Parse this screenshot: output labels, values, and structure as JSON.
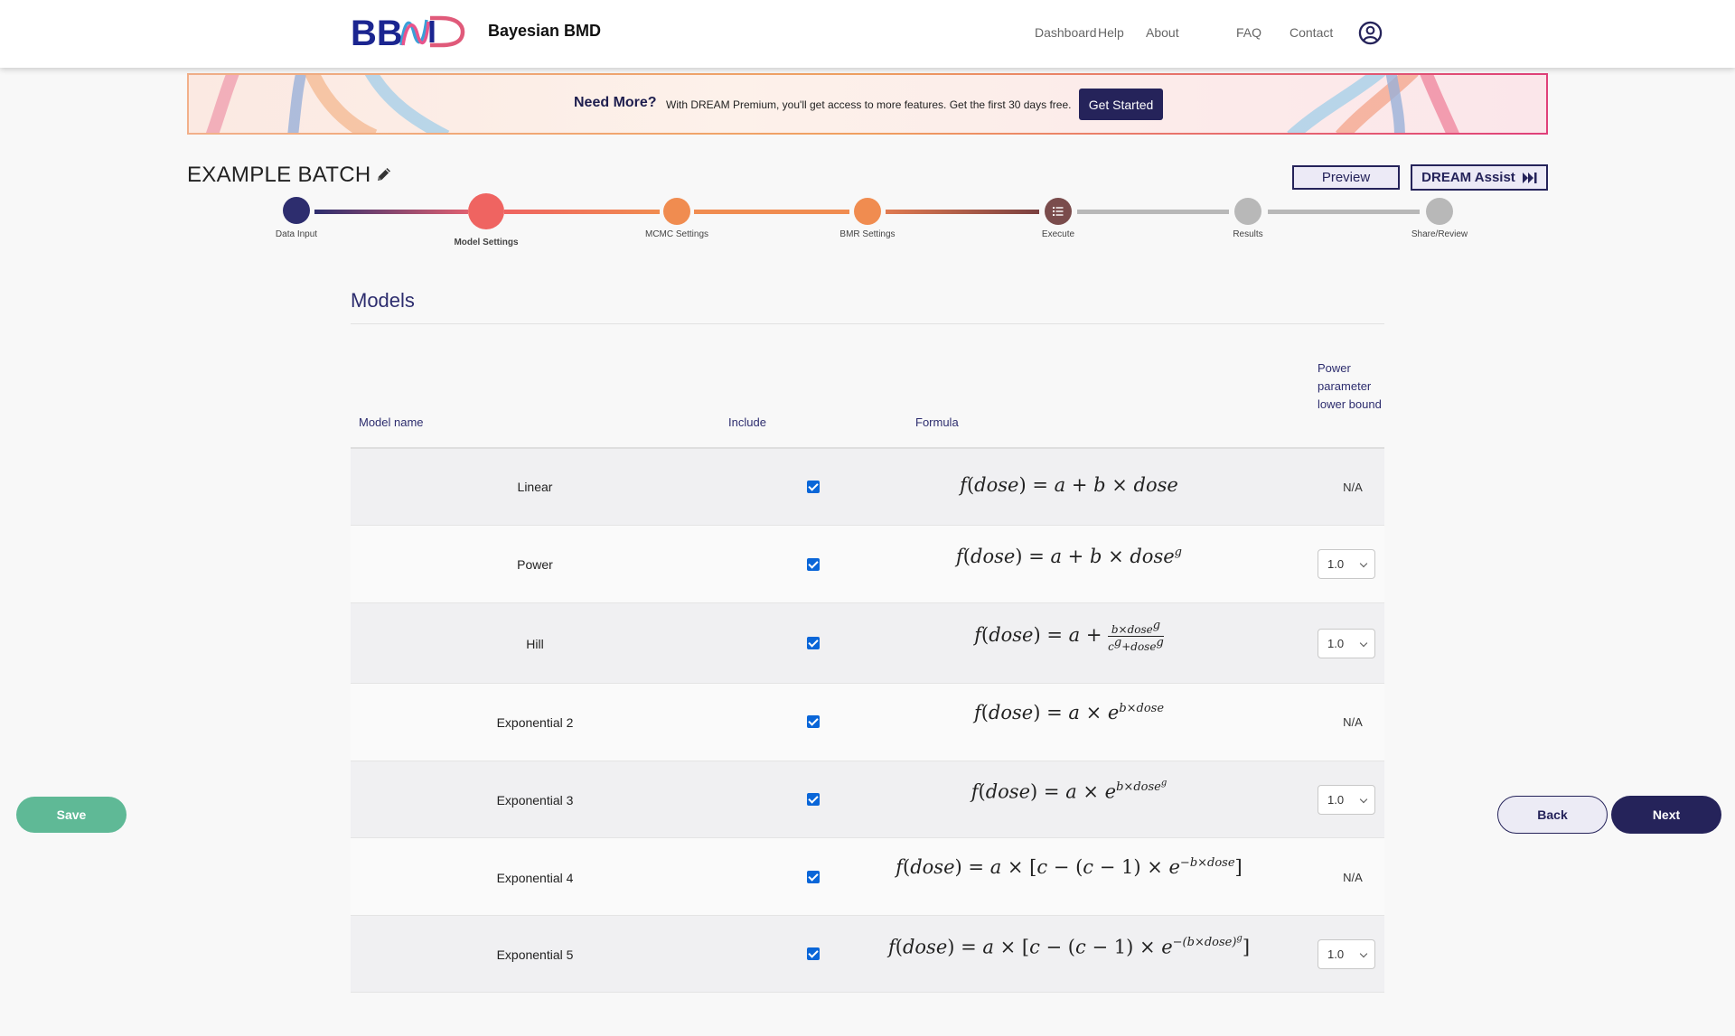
{
  "header": {
    "app_name": "Bayesian BMD",
    "logo_text": "BBMD",
    "nav": [
      "Dashboard",
      "Help",
      "About",
      "FAQ",
      "Contact"
    ],
    "user_icon": "user-circle-icon"
  },
  "banner": {
    "title": "Need More?",
    "text": "With DREAM Premium, you'll get access to more features. Get the first 30 days free.",
    "cta": "Get Started"
  },
  "batch": {
    "title": "EXAMPLE BATCH",
    "edit_icon": "pencil-icon",
    "preview_label": "Preview",
    "assist_label": "DREAM Assist",
    "assist_icon": "fast-forward-icon"
  },
  "stepper": {
    "steps": [
      "Data Input",
      "Model Settings",
      "MCMC Settings",
      "BMR Settings",
      "Execute",
      "Results",
      "Share/Review"
    ],
    "active_step": "Model Settings",
    "colors": {
      "done": "#2d2d6e",
      "active": "#ef6461",
      "upcoming": "#f08c50",
      "execute": "#7a4c4c",
      "inactive": "#b8b8b8"
    }
  },
  "models": {
    "section_title": "Models",
    "headers": {
      "name": "Model name",
      "include": "Include",
      "formula": "Formula",
      "power": "Power parameter lower bound"
    },
    "rows": [
      {
        "name": "Linear",
        "include": true,
        "power": "N/A"
      },
      {
        "name": "Power",
        "include": true,
        "power": "1.0"
      },
      {
        "name": "Hill",
        "include": true,
        "power": "1.0"
      },
      {
        "name": "Exponential 2",
        "include": true,
        "power": "N/A"
      },
      {
        "name": "Exponential 3",
        "include": true,
        "power": "1.0"
      },
      {
        "name": "Exponential 4",
        "include": true,
        "power": "N/A"
      },
      {
        "name": "Exponential 5",
        "include": true,
        "power": "1.0"
      }
    ]
  },
  "footer": {
    "save": "Save",
    "back": "Back",
    "next": "Next"
  }
}
